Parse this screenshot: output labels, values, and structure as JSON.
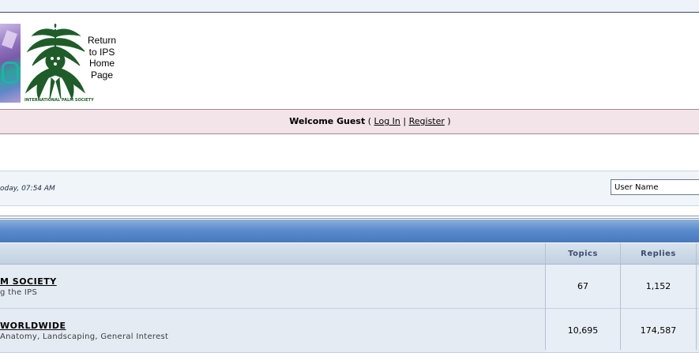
{
  "header": {
    "return_link": "Return to IPS Home Page",
    "logo_caption": "INTERNATIONAL PALM SOCIETY"
  },
  "welcome": {
    "prefix": "Welcome Guest",
    "open_paren": " ( ",
    "login": "Log In",
    "sep": " | ",
    "register": "Register",
    "close_paren": " )"
  },
  "datebar": {
    "date": "oday, 07:54 AM"
  },
  "login_form": {
    "username_value": "User Name"
  },
  "table": {
    "headers": {
      "topics": "Topics",
      "replies": "Replies"
    },
    "rows": [
      {
        "title": "M SOCIETY",
        "description": "g the IPS",
        "topics": "67",
        "replies": "1,152"
      },
      {
        "title": "WORLDWIDE",
        "description": "Anatomy, Landscaping, General Interest",
        "topics": "10,695",
        "replies": "174,587"
      }
    ]
  },
  "colors": {
    "header_blue": "#5b8ccc",
    "welcome_pink": "#f2e4e8",
    "row_bg": "#e4ebf3",
    "logo_green": "#1f5c2a"
  }
}
